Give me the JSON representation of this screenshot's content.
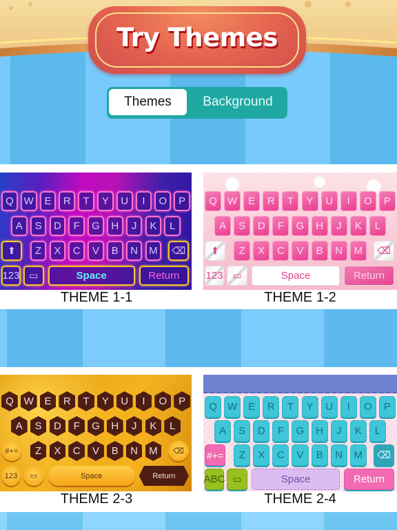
{
  "header": {
    "title": "Try Themes"
  },
  "segmented_control": {
    "options": [
      {
        "label": "Themes",
        "selected": true
      },
      {
        "label": "Background",
        "selected": false
      }
    ]
  },
  "colors": {
    "title_badge": "#d14c4b",
    "segment_accent": "#1fa8a2",
    "stripe_light": "#78c9fc",
    "stripe_dark": "#5bb9ee"
  },
  "keyboard_rows": {
    "row1": [
      "Q",
      "W",
      "E",
      "R",
      "T",
      "Y",
      "U",
      "I",
      "O",
      "P"
    ],
    "row2": [
      "A",
      "S",
      "D",
      "F",
      "G",
      "H",
      "J",
      "K",
      "L"
    ],
    "row3": [
      "Z",
      "X",
      "C",
      "V",
      "B",
      "N",
      "M"
    ]
  },
  "themes": [
    {
      "label": "THEME 1-1",
      "shift": "⬆",
      "num": "123",
      "space": "Space",
      "return": "Return",
      "delete": "⌫",
      "emoji": "▭"
    },
    {
      "label": "THEME 1-2",
      "shift": "⬆",
      "num": "123",
      "space": "Space",
      "return": "Return",
      "delete": "⌫",
      "emoji": "▭"
    },
    {
      "label": "THEME 2-3",
      "shift": "#+=",
      "num": "123",
      "space": "Space",
      "return": "Return",
      "delete": "⌫",
      "emoji": "▭"
    },
    {
      "label": "THEME 2-4",
      "shift": "#+=",
      "num": "ABC",
      "space": "Space",
      "return": "Return",
      "delete": "⌫",
      "emoji": "▭"
    }
  ]
}
